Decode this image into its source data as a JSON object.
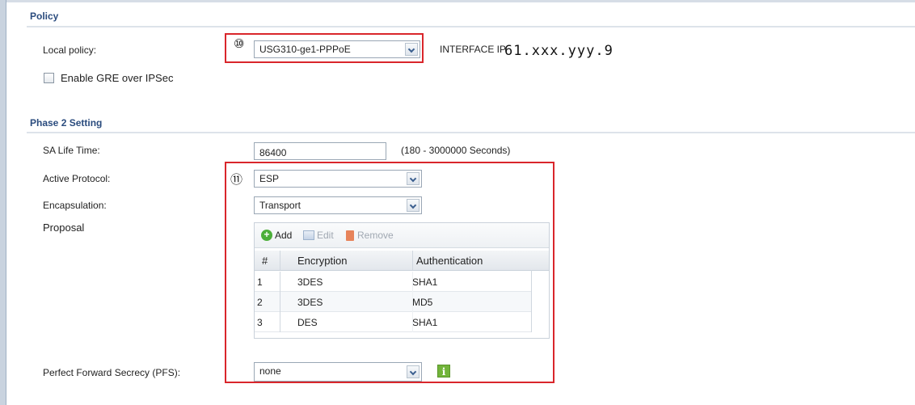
{
  "policy_section": {
    "title": "Policy",
    "local_policy_label": "Local policy:",
    "marker": "⑩",
    "local_policy_value": "USG310-ge1-PPPoE",
    "interface_ip_label": "INTERFACE IP",
    "interface_ip_value": "61.xxx.yyy.9",
    "gre_label": "Enable GRE over IPSec",
    "gre_checked": false
  },
  "phase2_section": {
    "title": "Phase 2 Setting",
    "marker": "⑪",
    "sa_life_label": "SA Life Time:",
    "sa_life_value": "86400",
    "sa_life_hint": "(180 - 3000000 Seconds)",
    "active_protocol_label": "Active Protocol:",
    "active_protocol_value": "ESP",
    "encapsulation_label": "Encapsulation:",
    "encapsulation_value": "Transport",
    "proposal_label": "Proposal",
    "toolbar": {
      "add": "Add",
      "edit": "Edit",
      "remove": "Remove"
    },
    "table": {
      "headers": [
        "#",
        "Encryption",
        "Authentication"
      ],
      "rows": [
        {
          "num": "1",
          "encryption": "3DES",
          "authentication": "SHA1"
        },
        {
          "num": "2",
          "encryption": "3DES",
          "authentication": "MD5"
        },
        {
          "num": "3",
          "encryption": "DES",
          "authentication": "SHA1"
        }
      ]
    },
    "pfs_label": "Perfect Forward Secrecy (PFS):",
    "pfs_value": "none",
    "info_icon_glyph": "i"
  },
  "colors": {
    "highlight_border": "#d9262b",
    "section_title": "#2b4c7e",
    "info_icon": "#72b43a"
  }
}
